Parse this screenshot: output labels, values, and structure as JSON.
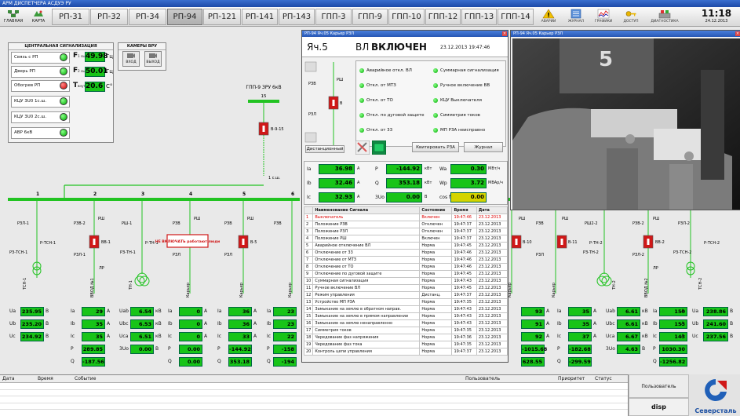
{
  "app_title": "АРМ ДИСПЕТЧЕРА АСДУЭ РУ",
  "nav": {
    "main_label": "ГЛАВНАЯ",
    "map_label": "КАРТА",
    "tabs": [
      "РП-31",
      "РП-32",
      "РП-34",
      "РП-94",
      "РП-121",
      "РП-141",
      "РП-143",
      "ГПП-3",
      "ГПП-9",
      "ГПП-10",
      "ГПП-12",
      "ГПП-13",
      "ГПП-14"
    ],
    "active_tab": "РП-94",
    "tools": [
      "АВАРИИ",
      "ЖУРНАЛ",
      "ГРАФИКИ",
      "ДОСТУП",
      "ДИАГНОСТИКА"
    ],
    "time": "11:18",
    "date": "24.12.2013"
  },
  "central_signal": {
    "title": "ЦЕНТРАЛЬНАЯ СИГНАЛИЗАЦИЯ",
    "rows": [
      {
        "label": "Связь с РП",
        "state": "green"
      },
      {
        "label": "Дверь РП",
        "state": "green"
      },
      {
        "label": "Обогрев РП",
        "state": "red"
      },
      {
        "label": "КЦУ 3U0 1с.ш.",
        "state": "green"
      },
      {
        "label": "КЦУ 3U0 2с.ш.",
        "state": "green"
      },
      {
        "label": "АВР 6кВ",
        "state": "green"
      }
    ],
    "freq1": {
      "label": "F",
      "sub": "1 сш",
      "value": "49.98",
      "unit": "Гц"
    },
    "freq2": {
      "label": "F",
      "sub": "2 сш",
      "value": "50.01",
      "unit": "Гц"
    },
    "temp": {
      "label": "T",
      "sub": "внутр",
      "value": "20.6",
      "unit": "C°"
    }
  },
  "cameras": {
    "title": "КАМЕРЫ ВРУ",
    "entry": "ВХОД",
    "exit": "ВЫХОД"
  },
  "schematic": {
    "gpp_label": "ГПП-9 ЗРУ 6кВ",
    "gpp_bus": "15",
    "feeder": "В-9-15",
    "section": "1 с.ш.",
    "cells": [
      "1",
      "2",
      "3",
      "4",
      "5",
      "6"
    ],
    "warning": "НЕ ВКЛЮЧАТЬ работают люди",
    "labels": {
      "rzl1": "РЗЛ-1",
      "rtsn1": "Р-ТСН-1",
      "rtsn1b": "РЗ-ТСН-1",
      "tsn1": "ТСН-1",
      "rzv2": "РЗВ-2",
      "rsh2": "РШ",
      "vv1": "ВВ-1",
      "rzl2": "РЗЛ-1",
      "lr": "ЛР",
      "vvod1": "ВВОД №1",
      "rsh3": "РШ-1",
      "rtn1": "Р-ТН-1",
      "rztn1": "РЗ-ТН-1",
      "tn1": "ТН-1",
      "rzv4": "РЗВ",
      "rsh4": "РШ",
      "rzl4": "РЗЛ",
      "kar4": "Карьер",
      "rzv5": "РЗВ",
      "rsh5": "РШ",
      "b5": "В-5",
      "rzl5": "РЗЛ",
      "kar5": "Карьер",
      "rzv6": "РЗВ",
      "kar6": "Карьер",
      "rsh10": "РШ",
      "b10": "В-10",
      "kar10": "Карьер",
      "rzv11": "РЗВ",
      "rsh11": "РШ",
      "b11": "В-11",
      "rzl11": "РЗЛ",
      "kar11": "Карьер",
      "rsh12": "РШ2-2",
      "rtn2": "Р-ТН-2",
      "rztn2": "РЗ-ТН-2",
      "tn2": "ТН-2",
      "rzv13": "РЗВ-2",
      "rsh13": "РШ",
      "vv2": "ВВ-2",
      "rzl13": "РЗЛ-2",
      "lr2": "ЛР",
      "vvod2": "ВВОД №2",
      "rzl14": "РЗЛ-2",
      "rtsn2": "Р-ТСН-2",
      "rtsn2b": "РЗ-ТСН-2",
      "tsn2": "ТСН-2"
    }
  },
  "bottom_values": {
    "voltages_left": [
      {
        "label": "Ua",
        "value": "235.95",
        "unit": "В"
      },
      {
        "label": "Ub",
        "value": "235.20",
        "unit": "В"
      },
      {
        "label": "Uc",
        "value": "234.92",
        "unit": "В"
      }
    ],
    "col2": [
      {
        "label": "Ia",
        "value": "29",
        "unit": "А"
      },
      {
        "label": "Ib",
        "value": "35",
        "unit": "А"
      },
      {
        "label": "Ic",
        "value": "35",
        "unit": "А"
      },
      {
        "label": "P",
        "value": "289.85",
        "unit": ""
      },
      {
        "label": "Q",
        "value": "-187.56",
        "unit": ""
      }
    ],
    "col3": [
      {
        "label": "Uab",
        "value": "6.54",
        "unit": "кВ"
      },
      {
        "label": "Ubc",
        "value": "6.53",
        "unit": "кВ"
      },
      {
        "label": "Uca",
        "value": "6.51",
        "unit": "кВ"
      },
      {
        "label": "3Uo",
        "value": "0.00",
        "unit": "В"
      }
    ],
    "col4": [
      {
        "label": "Ia",
        "value": "0",
        "unit": "А"
      },
      {
        "label": "Ib",
        "value": "0",
        "unit": "А"
      },
      {
        "label": "Ic",
        "value": "0",
        "unit": "А"
      },
      {
        "label": "P",
        "value": "0.00",
        "unit": ""
      },
      {
        "label": "Q",
        "value": "0.00",
        "unit": ""
      }
    ],
    "col5": [
      {
        "label": "Ia",
        "value": "36",
        "unit": "А"
      },
      {
        "label": "Ib",
        "value": "36",
        "unit": "А"
      },
      {
        "label": "Ic",
        "value": "33",
        "unit": "А"
      },
      {
        "label": "P",
        "value": "-144.92",
        "unit": ""
      },
      {
        "label": "Q",
        "value": "353.18",
        "unit": ""
      }
    ],
    "col6": [
      {
        "label": "Ia",
        "value": "23",
        "unit": ""
      },
      {
        "label": "Ib",
        "value": "23",
        "unit": ""
      },
      {
        "label": "Ic",
        "value": "22",
        "unit": ""
      },
      {
        "label": "P",
        "value": "-158",
        "unit": ""
      },
      {
        "label": "Q",
        "value": "-194",
        "unit": ""
      }
    ],
    "col10": [
      {
        "label": "",
        "value": "93",
        "unit": "А"
      },
      {
        "label": "",
        "value": "91",
        "unit": "А"
      },
      {
        "label": "",
        "value": "92",
        "unit": "А"
      },
      {
        "label": "",
        "value": "-1015.68",
        "unit": ""
      },
      {
        "label": "",
        "value": "628.55",
        "unit": ""
      }
    ],
    "col11": [
      {
        "label": "Ia",
        "value": "35",
        "unit": "А"
      },
      {
        "label": "Ib",
        "value": "35",
        "unit": "А"
      },
      {
        "label": "Ic",
        "value": "37",
        "unit": "А"
      },
      {
        "label": "P",
        "value": "-182.68",
        "unit": ""
      },
      {
        "label": "Q",
        "value": "-299.59",
        "unit": ""
      }
    ],
    "col12": [
      {
        "label": "Uab",
        "value": "6.61",
        "unit": "кВ"
      },
      {
        "label": "Ubc",
        "value": "6.61",
        "unit": "кВ"
      },
      {
        "label": "Uca",
        "value": "6.67",
        "unit": "кВ"
      },
      {
        "label": "3Uo",
        "value": "4.63",
        "unit": "В"
      }
    ],
    "col13": [
      {
        "label": "Ia",
        "value": "150",
        "unit": "А"
      },
      {
        "label": "Ib",
        "value": "153",
        "unit": "А"
      },
      {
        "label": "Ic",
        "value": "143",
        "unit": "А"
      },
      {
        "label": "P",
        "value": "1030.30",
        "unit": ""
      },
      {
        "label": "Q",
        "value": "-1256.82",
        "unit": ""
      }
    ],
    "voltages_right": [
      {
        "label": "Ua",
        "value": "238.86",
        "unit": "В"
      },
      {
        "label": "Ub",
        "value": "241.60",
        "unit": "В"
      },
      {
        "label": "Uc",
        "value": "237.56",
        "unit": "В"
      }
    ]
  },
  "cell_window": {
    "title": "РП-94 Яч.05 Карьер РЗЛ",
    "cell": "Яч.5",
    "status_prefix": "ВЛ",
    "status": "ВКЛЮЧЕН",
    "datetime": "23.12.2013 19:47:46",
    "prot_left": [
      "Аварийное откл. ВЛ",
      "Откл. от МТЗ",
      "Откл. от ТО",
      "Откл. по дуговой защите",
      "Откл. от 33"
    ],
    "prot_right": [
      "Суммарная сигнализация",
      "Ручное включение ВВ",
      "КЦУ Выключателя",
      "Симметрия токов",
      "МП РЗА неисправно"
    ],
    "mini": {
      "rzv": "РЗВ",
      "rsh": "РШ",
      "rzl": "РЗЛ",
      "v": "В",
      "mode": "Дистанционный"
    },
    "btn_ack": "Квитировать РЗА",
    "btn_journal": "Журнал",
    "measures": [
      {
        "l": "Ia",
        "v": "36.98",
        "u": "А",
        "l2": "P",
        "v2": "-144.92",
        "u2": "кВт",
        "l3": "Wa",
        "v3": "0.30",
        "u3": "МВт/ч"
      },
      {
        "l": "Ib",
        "v": "32.46",
        "u": "А",
        "l2": "Q",
        "v2": "353.18",
        "u2": "кВт",
        "l3": "Wp",
        "v3": "3.72",
        "u3": "МВАр/ч"
      },
      {
        "l": "Ic",
        "v": "32.93",
        "u": "А",
        "l2": "3Uo",
        "v2": "0.00",
        "u2": "В",
        "l3": "cos f",
        "v3": "0.00",
        "u3": ""
      }
    ],
    "table_headers": [
      "",
      "Наименование Сигнала",
      "Состояние",
      "Время",
      "Дата"
    ],
    "table_rows": [
      [
        "1",
        "Выключатель",
        "Включен",
        "19:47:46",
        "23.12.2013"
      ],
      [
        "2",
        "Положение РЗВ",
        "Отключен",
        "19:47:37",
        "23.12.2013"
      ],
      [
        "3",
        "Положение РЗЛ",
        "Отключен",
        "19:47:37",
        "23.12.2013"
      ],
      [
        "4",
        "Положение РШ",
        "Включен",
        "19:47:37",
        "23.12.2013"
      ],
      [
        "5",
        "Аварийное отключение ВЛ",
        "Норма",
        "19:47:45",
        "23.12.2013"
      ],
      [
        "6",
        "Отключение от 33",
        "Норма",
        "19:47:46",
        "23.12.2013"
      ],
      [
        "7",
        "Отключение от МТЗ",
        "Норма",
        "19:47:46",
        "23.12.2013"
      ],
      [
        "8",
        "Отключение от ТО",
        "Норма",
        "19:47:46",
        "23.12.2013"
      ],
      [
        "9",
        "Отключение по дуговой защите",
        "Норма",
        "19:47:45",
        "23.12.2013"
      ],
      [
        "10",
        "Суммарная сигнализация",
        "Норма",
        "19:47:43",
        "23.12.2013"
      ],
      [
        "11",
        "Ручное включение ВЛ",
        "Норма",
        "19:47:45",
        "23.12.2013"
      ],
      [
        "12",
        "Режим управления",
        "Дистанц.",
        "19:47:37",
        "23.12.2013"
      ],
      [
        "13",
        "Устройство МП РЗА",
        "Норма",
        "19:47:35",
        "23.12.2013"
      ],
      [
        "14",
        "Замыкание на землю в обратном направ.",
        "Норма",
        "19:47:43",
        "23.12.2013"
      ],
      [
        "15",
        "Замыкание на землю в прямом направлении",
        "Норма",
        "19:47:43",
        "23.12.2013"
      ],
      [
        "16",
        "Замыкание на землю ненаправленно",
        "Норма",
        "19:47:43",
        "23.12.2013"
      ],
      [
        "17",
        "Симметрия токов",
        "Норма",
        "19:47:35",
        "23.12.2013"
      ],
      [
        "18",
        "Чередование фаз напряжения",
        "Норма",
        "19:47:36",
        "23.12.2013"
      ],
      [
        "19",
        "Чередование фаз тока",
        "Норма",
        "19:47:35",
        "23.12.2013"
      ],
      [
        "20",
        "Контроль цепи управления",
        "Норма",
        "19:47:37",
        "23.12.2013"
      ]
    ]
  },
  "camera_window": {
    "title": "РП-94 Яч.05 Карьер РЗЛ",
    "cam_digit": "5"
  },
  "log": {
    "headers": [
      "Дата",
      "Время",
      "Событие",
      "Пользователь",
      "Приоритет",
      "Статус"
    ]
  },
  "user": {
    "label": "Пользователь",
    "name": "disp",
    "logo": "Северсталь"
  },
  "colors": {
    "green": "#18c418",
    "red": "#d01818",
    "bus": "#22c322"
  }
}
